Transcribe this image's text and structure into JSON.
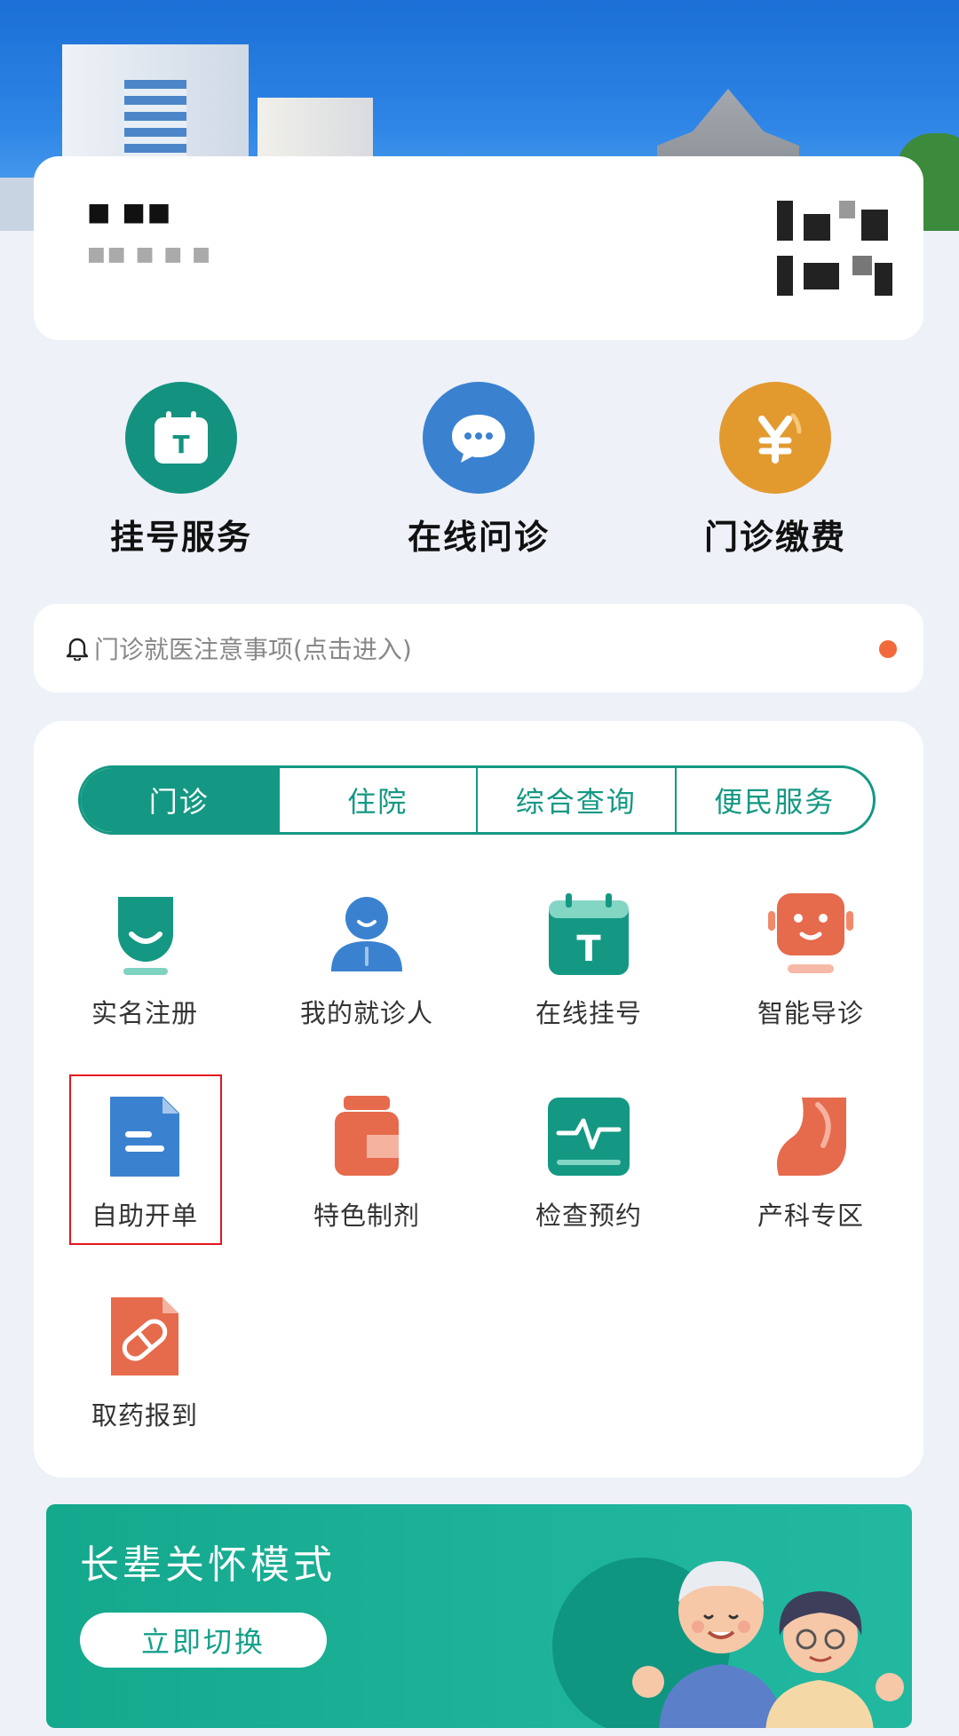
{
  "banner": {
    "image_semantic": "hospital-building-banner"
  },
  "user_card": {
    "name": "■ ■■",
    "sub": "■■  ■ ■ ■"
  },
  "quick_actions": [
    {
      "label": "挂号服务",
      "icon": "calendar-icon",
      "color": "#13937f"
    },
    {
      "label": "在线问诊",
      "icon": "chat-bubble-icon",
      "color": "#3a82d0"
    },
    {
      "label": "门诊缴费",
      "icon": "yen-coin-icon",
      "color": "#e29a2f"
    }
  ],
  "notice": {
    "text": "门诊就医注意事项(点击进入)",
    "icon": "bell-icon",
    "dot_color": "#f26a3b"
  },
  "tabs": [
    {
      "label": "门诊",
      "active": true
    },
    {
      "label": "住院",
      "active": false
    },
    {
      "label": "综合查询",
      "active": false
    },
    {
      "label": "便民服务",
      "active": false
    }
  ],
  "services": [
    {
      "label": "实名注册",
      "icon": "face-badge-icon"
    },
    {
      "label": "我的就诊人",
      "icon": "person-icon"
    },
    {
      "label": "在线挂号",
      "icon": "calendar-icon"
    },
    {
      "label": "智能导诊",
      "icon": "robot-icon"
    },
    {
      "label": "自助开单",
      "icon": "document-icon",
      "highlighted": true
    },
    {
      "label": "特色制剂",
      "icon": "medicine-bottle-icon"
    },
    {
      "label": "检查预约",
      "icon": "heartbeat-monitor-icon"
    },
    {
      "label": "产科专区",
      "icon": "pregnancy-icon"
    },
    {
      "label": "取药报到",
      "icon": "pill-icon"
    }
  ],
  "elder_mode": {
    "title": "长辈关怀模式",
    "button": "立即切换"
  },
  "colors": {
    "primary": "#149883",
    "highlight_border": "#e3161f",
    "background": "#eef1f8"
  }
}
